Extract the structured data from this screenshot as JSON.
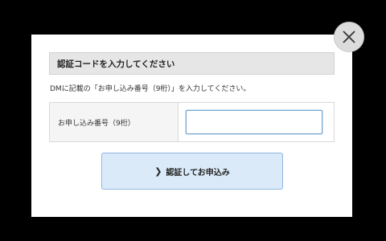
{
  "modal": {
    "heading": "認証コードを入力してください",
    "description": "DMに記載の「お申し込み番号（9桁）」を入力してください。",
    "form": {
      "label": "お申し込み番号（9桁）",
      "input_value": "",
      "input_placeholder": ""
    },
    "submit": {
      "label": "認証してお申込み",
      "icon": "chevron-right-icon"
    },
    "close": {
      "icon": "close-icon"
    }
  },
  "colors": {
    "backdrop": "#000000",
    "heading_bg": "#e6e6e6",
    "button_bg": "#daeaf8",
    "button_border": "#8fb8df",
    "input_focus_border": "#7aa6cf"
  }
}
